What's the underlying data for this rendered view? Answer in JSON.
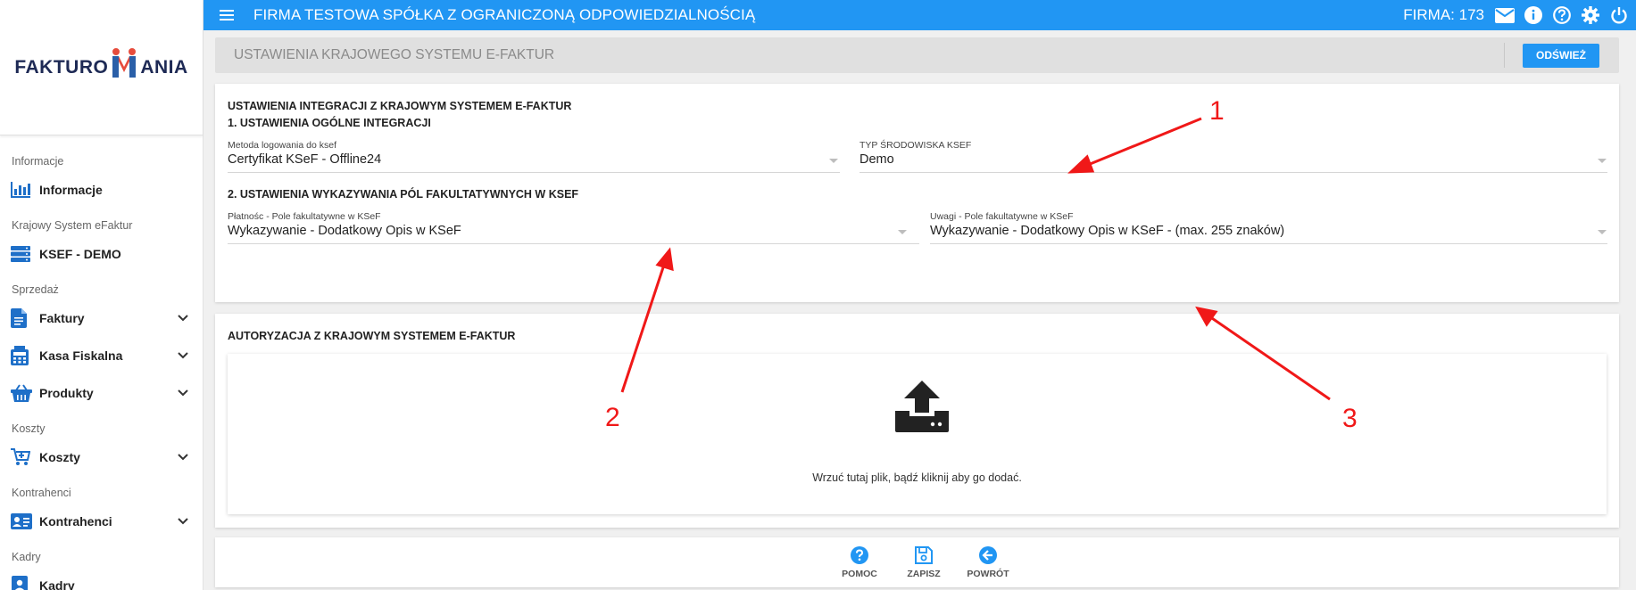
{
  "sidebar": {
    "logo_left": "FAKTURO",
    "logo_right": "ANIA",
    "items": [
      {
        "section": "Informacje",
        "label": "Informacje",
        "icon": "bar-chart-icon",
        "expandable": false
      },
      {
        "section": "Krajowy System eFaktur",
        "label": "KSEF - DEMO",
        "icon": "server-icon",
        "expandable": false
      },
      {
        "section": "Sprzedaż",
        "label": "Faktury",
        "icon": "document-icon",
        "expandable": true
      },
      {
        "section": "",
        "label": "Kasa Fiskalna",
        "icon": "calculator-icon",
        "expandable": true
      },
      {
        "section": "",
        "label": "Produkty",
        "icon": "basket-icon",
        "expandable": true
      },
      {
        "section": "Koszty",
        "label": "Koszty",
        "icon": "cart-add-icon",
        "expandable": true
      },
      {
        "section": "Kontrahenci",
        "label": "Kontrahenci",
        "icon": "id-card-icon",
        "expandable": true
      },
      {
        "section": "Kadry",
        "label": "Kadry",
        "icon": "contacts-icon",
        "expandable": false
      }
    ]
  },
  "topbar": {
    "company": "FIRMA TESTOWA SPÓŁKA Z OGRANICZONĄ ODPOWIEDZIALNOŚCIĄ",
    "firma": "FIRMA: 173",
    "icons": [
      "mail-icon",
      "info-icon",
      "help-icon",
      "settings-icon",
      "power-icon"
    ],
    "color": "#2196f3"
  },
  "header": {
    "title": "USTAWIENIA KRAJOWEGO SYSTEMU E-FAKTUR",
    "refresh_label": "ODŚWIEŻ"
  },
  "integration": {
    "title": "USTAWIENIA INTEGRACJI Z KRAJOWYM SYSTEMEM E-FAKTUR",
    "section1": "1. USTAWIENIA OGÓLNE INTEGRACJI",
    "login_label": "Metoda logowania do ksef",
    "login_value": "Certyfikat KSeF - Offline24",
    "env_label": "TYP ŚRODOWISKA KSEF",
    "env_value": "Demo",
    "section2": "2. USTAWIENIA WYKAZYWANIA PÓL FAKULTATYWNYCH W KSEF",
    "payment_label": "Płatnośc - Pole fakultatywne w KSeF",
    "payment_value": "Wykazywanie - Dodatkowy Opis w KSeF",
    "notes_label": "Uwagi - Pole fakultatywne w KSeF",
    "notes_value": "Wykazywanie - Dodatkowy Opis w KSeF - (max. 255 znaków)"
  },
  "authorization": {
    "title": "AUTORYZACJA Z KRAJOWYM SYSTEMEM E-FAKTUR",
    "dropzone_text": "Wrzuć tutaj plik, bądź kliknij aby go dodać."
  },
  "actions": {
    "help": "POMOC",
    "save": "ZAPISZ",
    "back": "POWRÓT"
  },
  "annotations": {
    "n1": "1",
    "n2": "2",
    "n3": "3",
    "color": "#f01818"
  }
}
